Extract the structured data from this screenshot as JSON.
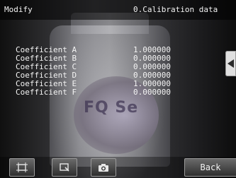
{
  "header": {
    "mode": "Modify",
    "title": "0.Calibration data"
  },
  "coefficients": [
    {
      "label": "Coefficient A",
      "value": "1.000000"
    },
    {
      "label": "Coefficient B",
      "value": "0.000000"
    },
    {
      "label": "Coefficient C",
      "value": "0.000000"
    },
    {
      "label": "Coefficient D",
      "value": "0.000000"
    },
    {
      "label": "Coefficient E",
      "value": "1.000000"
    },
    {
      "label": "Coefficient F",
      "value": "0.000000"
    }
  ],
  "image_overlay_text": "FQ Se",
  "toolbar": {
    "buttons": [
      {
        "icon": "fit-frame-icon"
      },
      {
        "icon": "zoom-icon"
      },
      {
        "icon": "camera-icon"
      }
    ],
    "back_label": "Back"
  },
  "side_button_icon": "arrow-left-icon",
  "colors": {
    "text": "#f4f4f4",
    "button_bg": "#4a4a4a",
    "button_border": "#9a9a9a"
  }
}
